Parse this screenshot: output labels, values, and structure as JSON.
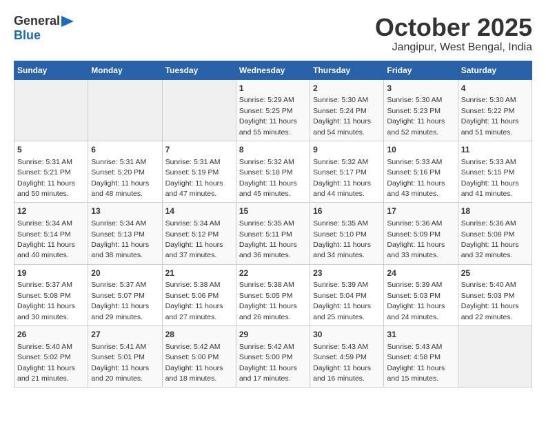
{
  "logo": {
    "general": "General",
    "blue": "Blue"
  },
  "title": "October 2025",
  "subtitle": "Jangipur, West Bengal, India",
  "weekdays": [
    "Sunday",
    "Monday",
    "Tuesday",
    "Wednesday",
    "Thursday",
    "Friday",
    "Saturday"
  ],
  "weeks": [
    [
      {
        "num": "",
        "sunrise": "",
        "sunset": "",
        "daylight": ""
      },
      {
        "num": "",
        "sunrise": "",
        "sunset": "",
        "daylight": ""
      },
      {
        "num": "",
        "sunrise": "",
        "sunset": "",
        "daylight": ""
      },
      {
        "num": "1",
        "sunrise": "Sunrise: 5:29 AM",
        "sunset": "Sunset: 5:25 PM",
        "daylight": "Daylight: 11 hours and 55 minutes."
      },
      {
        "num": "2",
        "sunrise": "Sunrise: 5:30 AM",
        "sunset": "Sunset: 5:24 PM",
        "daylight": "Daylight: 11 hours and 54 minutes."
      },
      {
        "num": "3",
        "sunrise": "Sunrise: 5:30 AM",
        "sunset": "Sunset: 5:23 PM",
        "daylight": "Daylight: 11 hours and 52 minutes."
      },
      {
        "num": "4",
        "sunrise": "Sunrise: 5:30 AM",
        "sunset": "Sunset: 5:22 PM",
        "daylight": "Daylight: 11 hours and 51 minutes."
      }
    ],
    [
      {
        "num": "5",
        "sunrise": "Sunrise: 5:31 AM",
        "sunset": "Sunset: 5:21 PM",
        "daylight": "Daylight: 11 hours and 50 minutes."
      },
      {
        "num": "6",
        "sunrise": "Sunrise: 5:31 AM",
        "sunset": "Sunset: 5:20 PM",
        "daylight": "Daylight: 11 hours and 48 minutes."
      },
      {
        "num": "7",
        "sunrise": "Sunrise: 5:31 AM",
        "sunset": "Sunset: 5:19 PM",
        "daylight": "Daylight: 11 hours and 47 minutes."
      },
      {
        "num": "8",
        "sunrise": "Sunrise: 5:32 AM",
        "sunset": "Sunset: 5:18 PM",
        "daylight": "Daylight: 11 hours and 45 minutes."
      },
      {
        "num": "9",
        "sunrise": "Sunrise: 5:32 AM",
        "sunset": "Sunset: 5:17 PM",
        "daylight": "Daylight: 11 hours and 44 minutes."
      },
      {
        "num": "10",
        "sunrise": "Sunrise: 5:33 AM",
        "sunset": "Sunset: 5:16 PM",
        "daylight": "Daylight: 11 hours and 43 minutes."
      },
      {
        "num": "11",
        "sunrise": "Sunrise: 5:33 AM",
        "sunset": "Sunset: 5:15 PM",
        "daylight": "Daylight: 11 hours and 41 minutes."
      }
    ],
    [
      {
        "num": "12",
        "sunrise": "Sunrise: 5:34 AM",
        "sunset": "Sunset: 5:14 PM",
        "daylight": "Daylight: 11 hours and 40 minutes."
      },
      {
        "num": "13",
        "sunrise": "Sunrise: 5:34 AM",
        "sunset": "Sunset: 5:13 PM",
        "daylight": "Daylight: 11 hours and 38 minutes."
      },
      {
        "num": "14",
        "sunrise": "Sunrise: 5:34 AM",
        "sunset": "Sunset: 5:12 PM",
        "daylight": "Daylight: 11 hours and 37 minutes."
      },
      {
        "num": "15",
        "sunrise": "Sunrise: 5:35 AM",
        "sunset": "Sunset: 5:11 PM",
        "daylight": "Daylight: 11 hours and 36 minutes."
      },
      {
        "num": "16",
        "sunrise": "Sunrise: 5:35 AM",
        "sunset": "Sunset: 5:10 PM",
        "daylight": "Daylight: 11 hours and 34 minutes."
      },
      {
        "num": "17",
        "sunrise": "Sunrise: 5:36 AM",
        "sunset": "Sunset: 5:09 PM",
        "daylight": "Daylight: 11 hours and 33 minutes."
      },
      {
        "num": "18",
        "sunrise": "Sunrise: 5:36 AM",
        "sunset": "Sunset: 5:08 PM",
        "daylight": "Daylight: 11 hours and 32 minutes."
      }
    ],
    [
      {
        "num": "19",
        "sunrise": "Sunrise: 5:37 AM",
        "sunset": "Sunset: 5:08 PM",
        "daylight": "Daylight: 11 hours and 30 minutes."
      },
      {
        "num": "20",
        "sunrise": "Sunrise: 5:37 AM",
        "sunset": "Sunset: 5:07 PM",
        "daylight": "Daylight: 11 hours and 29 minutes."
      },
      {
        "num": "21",
        "sunrise": "Sunrise: 5:38 AM",
        "sunset": "Sunset: 5:06 PM",
        "daylight": "Daylight: 11 hours and 27 minutes."
      },
      {
        "num": "22",
        "sunrise": "Sunrise: 5:38 AM",
        "sunset": "Sunset: 5:05 PM",
        "daylight": "Daylight: 11 hours and 26 minutes."
      },
      {
        "num": "23",
        "sunrise": "Sunrise: 5:39 AM",
        "sunset": "Sunset: 5:04 PM",
        "daylight": "Daylight: 11 hours and 25 minutes."
      },
      {
        "num": "24",
        "sunrise": "Sunrise: 5:39 AM",
        "sunset": "Sunset: 5:03 PM",
        "daylight": "Daylight: 11 hours and 24 minutes."
      },
      {
        "num": "25",
        "sunrise": "Sunrise: 5:40 AM",
        "sunset": "Sunset: 5:03 PM",
        "daylight": "Daylight: 11 hours and 22 minutes."
      }
    ],
    [
      {
        "num": "26",
        "sunrise": "Sunrise: 5:40 AM",
        "sunset": "Sunset: 5:02 PM",
        "daylight": "Daylight: 11 hours and 21 minutes."
      },
      {
        "num": "27",
        "sunrise": "Sunrise: 5:41 AM",
        "sunset": "Sunset: 5:01 PM",
        "daylight": "Daylight: 11 hours and 20 minutes."
      },
      {
        "num": "28",
        "sunrise": "Sunrise: 5:42 AM",
        "sunset": "Sunset: 5:00 PM",
        "daylight": "Daylight: 11 hours and 18 minutes."
      },
      {
        "num": "29",
        "sunrise": "Sunrise: 5:42 AM",
        "sunset": "Sunset: 5:00 PM",
        "daylight": "Daylight: 11 hours and 17 minutes."
      },
      {
        "num": "30",
        "sunrise": "Sunrise: 5:43 AM",
        "sunset": "Sunset: 4:59 PM",
        "daylight": "Daylight: 11 hours and 16 minutes."
      },
      {
        "num": "31",
        "sunrise": "Sunrise: 5:43 AM",
        "sunset": "Sunset: 4:58 PM",
        "daylight": "Daylight: 11 hours and 15 minutes."
      },
      {
        "num": "",
        "sunrise": "",
        "sunset": "",
        "daylight": ""
      }
    ]
  ]
}
